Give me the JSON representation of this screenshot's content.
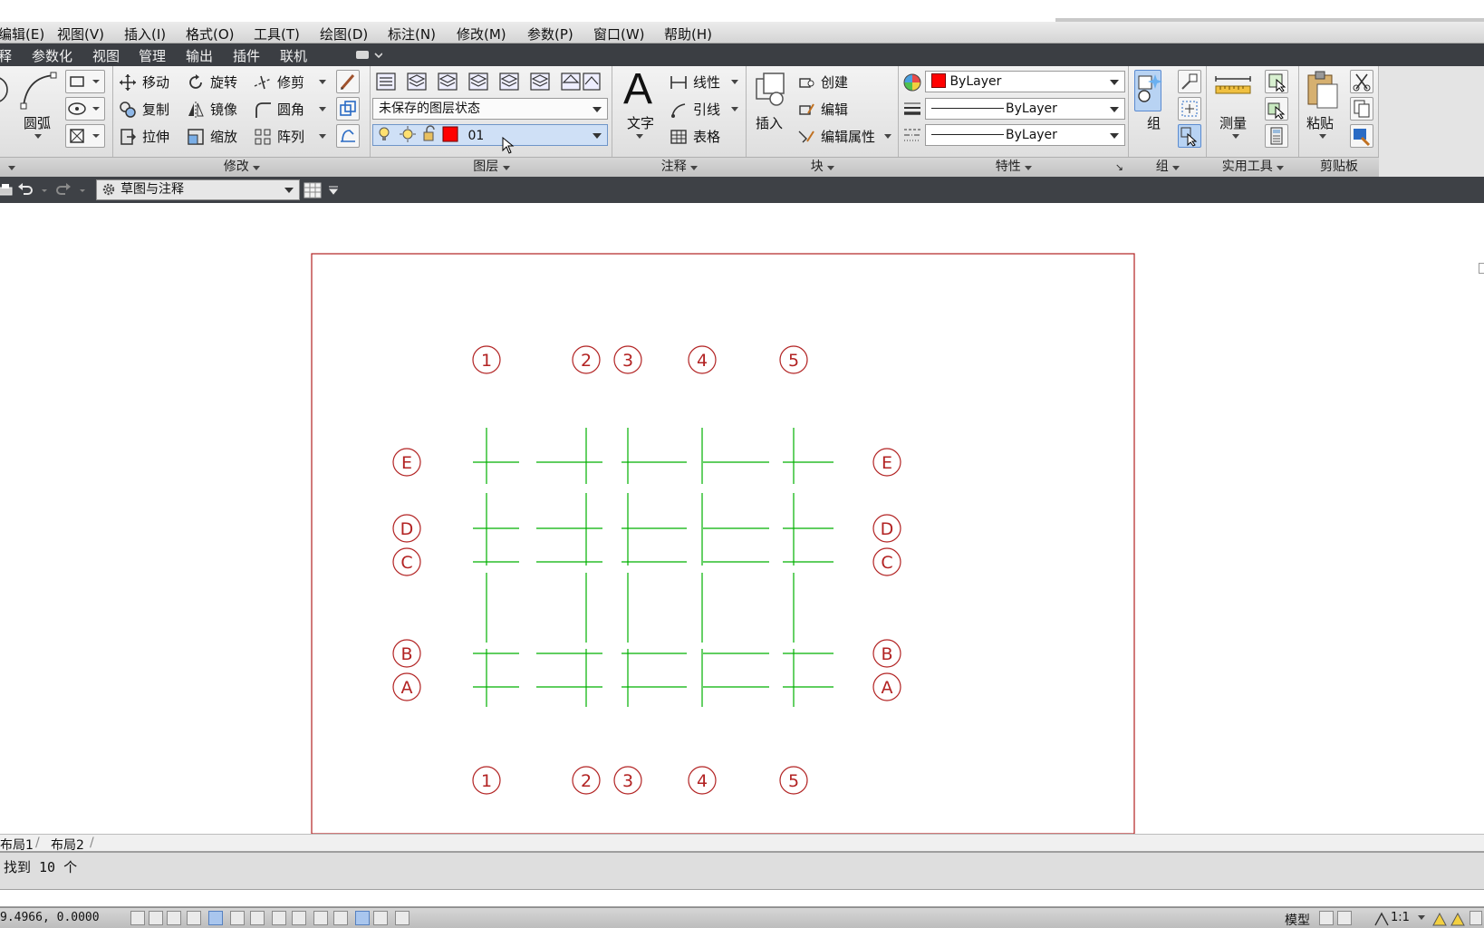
{
  "menu": [
    "编辑(E)",
    "视图(V)",
    "插入(I)",
    "格式(O)",
    "工具(T)",
    "绘图(D)",
    "标注(N)",
    "修改(M)",
    "参数(P)",
    "窗口(W)",
    "帮助(H)"
  ],
  "ribbon_tabs": [
    "释",
    "参数化",
    "视图",
    "管理",
    "输出",
    "插件",
    "联机"
  ],
  "draw_panel": {
    "arc_label": "圆弧"
  },
  "modify_panel": {
    "title": "修改",
    "move": "移动",
    "rotate": "旋转",
    "trim": "修剪",
    "copy": "复制",
    "mirror": "镜像",
    "fillet": "圆角",
    "stretch": "拉伸",
    "scale": "缩放",
    "array": "阵列"
  },
  "layers_panel": {
    "title": "图层",
    "layer_state": "未保存的图层状态",
    "current_layer": "01"
  },
  "annotation_panel": {
    "title": "注释",
    "text": "文字",
    "linear": "线性",
    "leader": "引线",
    "table": "表格"
  },
  "block_panel": {
    "title": "块",
    "insert": "插入",
    "create": "创建",
    "edit": "编辑",
    "edit_attributes": "编辑属性"
  },
  "properties_panel": {
    "title": "特性",
    "color": "ByLayer",
    "lineweight": "ByLayer",
    "linetype": "ByLayer"
  },
  "group_panel": {
    "title": "组",
    "group": "组"
  },
  "utilities_panel": {
    "title": "实用工具",
    "measure": "测量"
  },
  "clipboard_panel": {
    "title": "剪贴板",
    "paste": "粘贴"
  },
  "quick_access": {
    "workspace": "草图与注释"
  },
  "drawing": {
    "column_labels": [
      "1",
      "2",
      "3",
      "4",
      "5"
    ],
    "row_labels": [
      "E",
      "D",
      "C",
      "B",
      "A"
    ],
    "colors": {
      "bubble": "#b22222",
      "grid": "#00b000",
      "frame": "#b22222"
    }
  },
  "layout_tabs": [
    "布局1",
    "布局2"
  ],
  "command_line": "找到 10 个",
  "status": {
    "coords": "9.4966, 0.0000",
    "model": "模型",
    "scale": "1:1"
  }
}
